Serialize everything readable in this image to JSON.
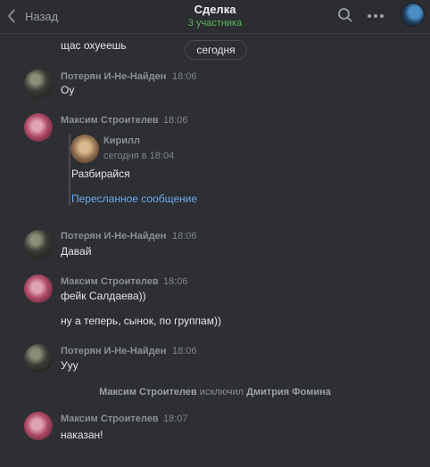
{
  "header": {
    "back_label": "Назад",
    "title": "Сделка",
    "subtitle": "3 участника",
    "back_icon": "chevron-left-icon",
    "search_icon": "search-icon",
    "more_icon": "more-icon"
  },
  "date_separator": "сегодня",
  "partial_message": "щас охуеешь",
  "messages": [
    {
      "author": "Потерян И-Не-Найден",
      "time": "18:06",
      "lines": [
        "Оу"
      ]
    },
    {
      "author": "Максим Строителев",
      "time": "18:06",
      "forwarded": {
        "author": "Кирилл",
        "time": "сегодня в 18:04",
        "text": "Разбирайся",
        "link": "Пересланное сообщение"
      }
    },
    {
      "author": "Потерян И-Не-Найден",
      "time": "18:06",
      "lines": [
        "Давай"
      ]
    },
    {
      "author": "Максим Строителев",
      "time": "18:06",
      "lines": [
        "фейк Салдаева))",
        "ну а теперь, сынок, по группам))"
      ]
    },
    {
      "author": "Потерян И-Не-Найден",
      "time": "18:06",
      "lines": [
        "Ууу"
      ]
    },
    {
      "author": "Максим Строителев",
      "time": "18:07",
      "lines": [
        "наказан!"
      ]
    }
  ],
  "service": {
    "actor": "Максим Строителев",
    "action": "исключил",
    "target": "Дмитрия Фомина"
  },
  "colors": {
    "background": "#2d2f33",
    "link": "#71aaeb",
    "online": "#5fb35f"
  }
}
